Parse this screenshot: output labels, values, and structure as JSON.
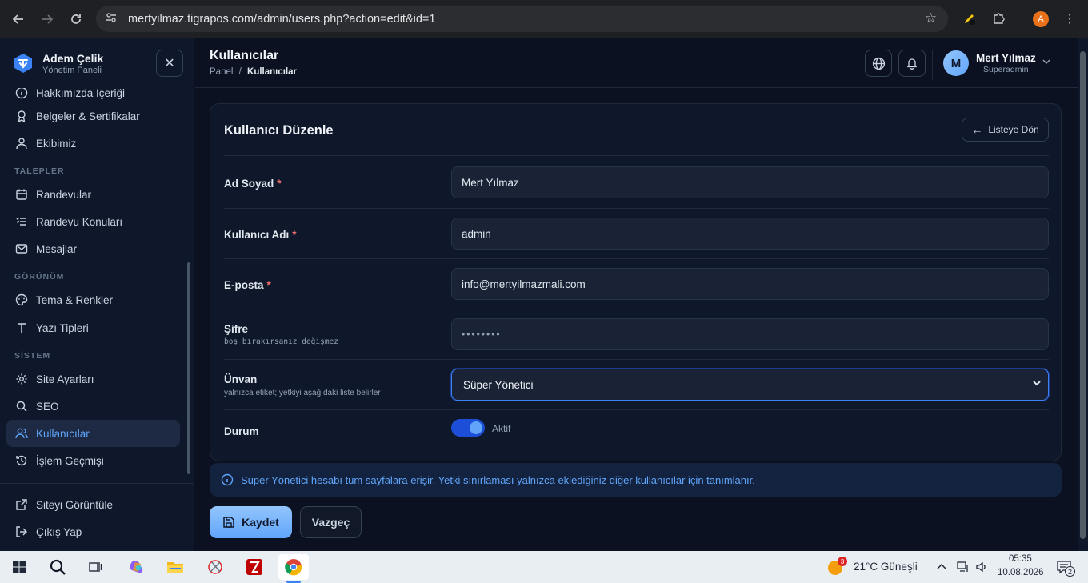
{
  "browser": {
    "url": "mertyilmaz.tigrapos.com/admin/users.php?action=edit&id=1",
    "profile_initial": "A"
  },
  "sidebar": {
    "brand_name": "Adem Çelik",
    "brand_sub": "Yönetim Paneli",
    "items": [
      {
        "label": "Hakkımızda İçeriği",
        "icon": "info-icon"
      },
      {
        "label": "Belgeler & Sertifikalar",
        "icon": "award-icon"
      },
      {
        "label": "Ekibimiz",
        "icon": "user-icon"
      },
      {
        "label": "Randevular",
        "icon": "calendar-icon"
      },
      {
        "label": "Randevu Konuları",
        "icon": "list-icon"
      },
      {
        "label": "Mesajlar",
        "icon": "mail-icon"
      },
      {
        "label": "Tema & Renkler",
        "icon": "palette-icon"
      },
      {
        "label": "Yazı Tipleri",
        "icon": "type-icon"
      },
      {
        "label": "Site Ayarları",
        "icon": "gear-icon"
      },
      {
        "label": "SEO",
        "icon": "search-icon"
      },
      {
        "label": "Kullanıcılar",
        "icon": "users-icon"
      },
      {
        "label": "İşlem Geçmişi",
        "icon": "history-icon"
      }
    ],
    "sections": {
      "talepler": "TALEPLER",
      "gorunum": "GÖRÜNÜM",
      "sistem": "SİSTEM"
    },
    "bottom": [
      {
        "label": "Siteyi Görüntüle",
        "icon": "external-link-icon"
      },
      {
        "label": "Çıkış Yap",
        "icon": "logout-icon"
      }
    ]
  },
  "header": {
    "title": "Kullanıcılar",
    "breadcrumb_root": "Panel",
    "breadcrumb_sep": "/",
    "breadcrumb_current": "Kullanıcılar",
    "user_initial": "M",
    "user_name": "Mert Yılmaz",
    "user_role": "Superadmin"
  },
  "form": {
    "title": "Kullanıcı Düzenle",
    "back_label": "Listeye Dön",
    "fields": {
      "name": {
        "label": "Ad Soyad",
        "required": "*",
        "value": "Mert Yılmaz"
      },
      "username": {
        "label": "Kullanıcı Adı",
        "required": "*",
        "value": "admin"
      },
      "email": {
        "label": "E-posta",
        "required": "*",
        "value": "info@mertyilmazmali.com"
      },
      "password": {
        "label": "Şifre",
        "hint": "boş bırakırsanız değişmez",
        "value": "••••••••"
      },
      "title": {
        "label": "Ünvan",
        "hint": "yalnızca etiket; yetkiyi aşağıdaki liste belirler",
        "value": "Süper Yönetici"
      },
      "status": {
        "label": "Durum",
        "value": "Aktif",
        "on": true
      }
    },
    "info": "Süper Yönetici hesabı tüm sayfalara erişir. Yetki sınırlaması yalnızca eklediğiniz diğer kullanıcılar için tanımlanır.",
    "save_label": "Kaydet",
    "cancel_label": "Vazgeç"
  },
  "taskbar": {
    "weather_badge": "3",
    "weather": "21°C  Güneşli",
    "time": "05:35",
    "date": "10.08.2026",
    "notification_count": "2"
  },
  "colors": {
    "accent": "#60a5fa",
    "background": "#0b1120",
    "panel": "#0f172a",
    "required": "#f87171"
  }
}
